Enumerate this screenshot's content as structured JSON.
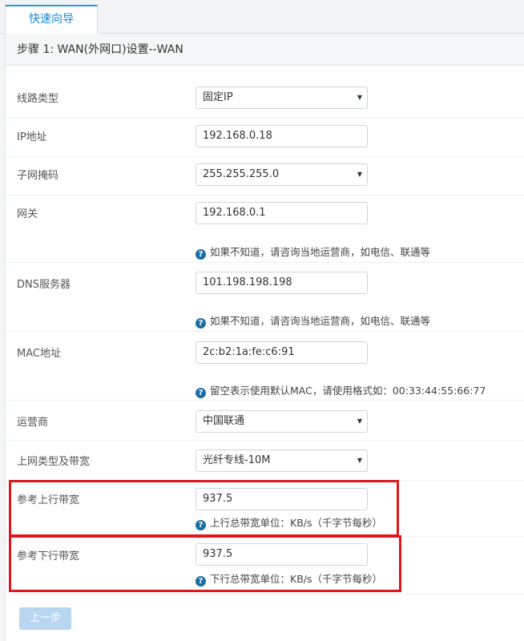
{
  "tabs": {
    "active": "快速向导"
  },
  "step_title": "步骤 1: WAN(外网口)设置--WAN",
  "form": {
    "line_type": {
      "label": "线路类型",
      "value": "固定IP"
    },
    "ip": {
      "label": "IP地址",
      "value": "192.168.0.18"
    },
    "subnet": {
      "label": "子网掩码",
      "value": "255.255.255.0"
    },
    "gateway": {
      "label": "网关",
      "value": "192.168.0.1",
      "hint": "如果不知道，请咨询当地运营商，如电信、联通等"
    },
    "dns": {
      "label": "DNS服务器",
      "value": "101.198.198.198",
      "hint": "如果不知道，请咨询当地运营商，如电信、联通等"
    },
    "mac": {
      "label": "MAC地址",
      "value": "2c:b2:1a:fe:c6:91",
      "hint": "留空表示使用默认MAC，请使用格式如：00:33:44:55:66:77"
    },
    "isp": {
      "label": "运营商",
      "value": "中国联通"
    },
    "bandwidth_type": {
      "label": "上网类型及带宽",
      "value": "光纤专线-10M"
    },
    "upload": {
      "label": "参考上行带宽",
      "value": "937.5",
      "hint": "上行总带宽单位：KB/s（千字节每秒）"
    },
    "download": {
      "label": "参考下行带宽",
      "value": "937.5",
      "hint": "下行总带宽单位：KB/s（千字节每秒）"
    }
  },
  "buttons": {
    "prev": "上一步"
  },
  "icons": {
    "select_arrow": "▼",
    "help": "?"
  },
  "colors": {
    "accent": "#1a8ad6",
    "highlight": "#e0161d",
    "help_icon": "#1c6ea4"
  }
}
